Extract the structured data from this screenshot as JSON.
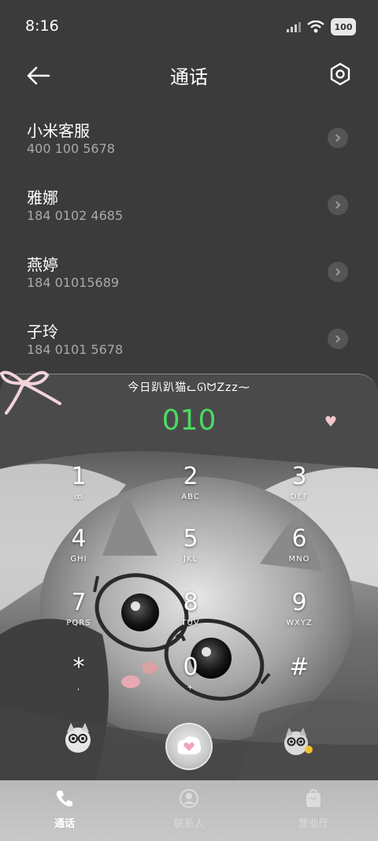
{
  "status_bar": {
    "time": "8:16",
    "battery": "100"
  },
  "header": {
    "title": "通话"
  },
  "calls": [
    {
      "name": "小米客服",
      "number": "400 100 5678"
    },
    {
      "name": "雅娜",
      "number": "184 0102 4685"
    },
    {
      "name": "燕婷",
      "number": "184 01015689"
    },
    {
      "name": "子玲",
      "number": "184 0101 5678"
    }
  ],
  "dialer": {
    "caption": "今日趴趴猫ᓚᘏᗢZzz⁓",
    "display": "010",
    "keys": [
      {
        "digit": "1",
        "letters": "ꝏ"
      },
      {
        "digit": "2",
        "letters": "ABC"
      },
      {
        "digit": "3",
        "letters": "DEF"
      },
      {
        "digit": "4",
        "letters": "GHI"
      },
      {
        "digit": "5",
        "letters": "JKL"
      },
      {
        "digit": "6",
        "letters": "MNO"
      },
      {
        "digit": "7",
        "letters": "PQRS"
      },
      {
        "digit": "8",
        "letters": "TUV"
      },
      {
        "digit": "9",
        "letters": "WXYZ"
      },
      {
        "digit": "*",
        "letters": ","
      },
      {
        "digit": "0",
        "letters": "+"
      },
      {
        "digit": "#",
        "letters": ""
      }
    ]
  },
  "bottom_nav": [
    {
      "label": "通话",
      "icon": "phone-icon"
    },
    {
      "label": "联系人",
      "icon": "person-icon"
    },
    {
      "label": "营业厅",
      "icon": "bag-icon"
    }
  ],
  "colors": {
    "accent_green": "#4cd964",
    "background": "#3b3b3c"
  }
}
